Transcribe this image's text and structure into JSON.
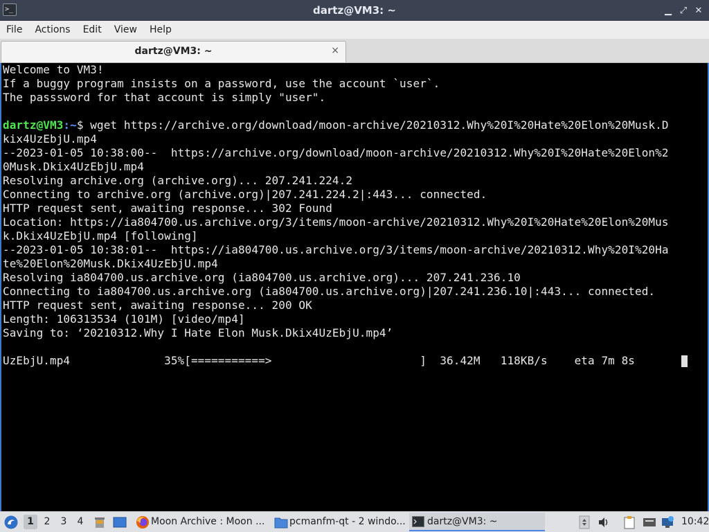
{
  "window": {
    "title": "dartz@VM3: ~",
    "controls": {
      "minimize": "▁",
      "maximize": "⤢",
      "close": "✕"
    }
  },
  "menu": [
    "File",
    "Actions",
    "Edit",
    "View",
    "Help"
  ],
  "tab": {
    "label": "dartz@VM3: ~",
    "close": "×"
  },
  "terminal": {
    "lines": [
      "Welcome to VM3!",
      "If a buggy program insists on a password, use the account `user`.",
      "The passsword for that account is simply \"user\".",
      "",
      "",
      "kix4UzEbjU.mp4",
      "--2023-01-05 10:38:00--  https://archive.org/download/moon-archive/20210312.Why%20I%20Hate%20Elon%2",
      "0Musk.Dkix4UzEbjU.mp4",
      "Resolving archive.org (archive.org)... 207.241.224.2",
      "Connecting to archive.org (archive.org)|207.241.224.2|:443... connected.",
      "HTTP request sent, awaiting response... 302 Found",
      "Location: https://ia804700.us.archive.org/3/items/moon-archive/20210312.Why%20I%20Hate%20Elon%20Mus",
      "k.Dkix4UzEbjU.mp4 [following]",
      "--2023-01-05 10:38:01--  https://ia804700.us.archive.org/3/items/moon-archive/20210312.Why%20I%20Ha",
      "te%20Elon%20Musk.Dkix4UzEbjU.mp4",
      "Resolving ia804700.us.archive.org (ia804700.us.archive.org)... 207.241.236.10",
      "Connecting to ia804700.us.archive.org (ia804700.us.archive.org)|207.241.236.10|:443... connected.",
      "HTTP request sent, awaiting response... 200 OK",
      "Length: 106313534 (101M) [video/mp4]",
      "Saving to: ‘20210312.Why I Hate Elon Musk.Dkix4UzEbjU.mp4’",
      "",
      "UzEbjU.mp4              35%[===========>                      ]  36.42M   118KB/s    eta 7m 8s  "
    ],
    "prompt": {
      "user_host": "dartz@VM3",
      "path": ":~",
      "symbol": "$ ",
      "command": "wget https://archive.org/download/moon-archive/20210312.Why%20I%20Hate%20Elon%20Musk.D"
    },
    "download_progress_percent": 35
  },
  "taskbar": {
    "desktops": [
      "1",
      "2",
      "3",
      "4"
    ],
    "active_desktop": "1",
    "tasks": [
      {
        "label": "Moon Archive : Moon ...",
        "icon": "firefox-icon"
      },
      {
        "label": "pcmanfm-qt - 2 windo...",
        "icon": "folder-icon"
      },
      {
        "label": "dartz@VM3: ~",
        "icon": "terminal-icon"
      }
    ],
    "clock": "10:42"
  },
  "colors": {
    "prompt_user": "#4fe650",
    "prompt_path": "#5c8eff",
    "titlebar": "#3b4252",
    "accent": "#3c7bd0"
  }
}
